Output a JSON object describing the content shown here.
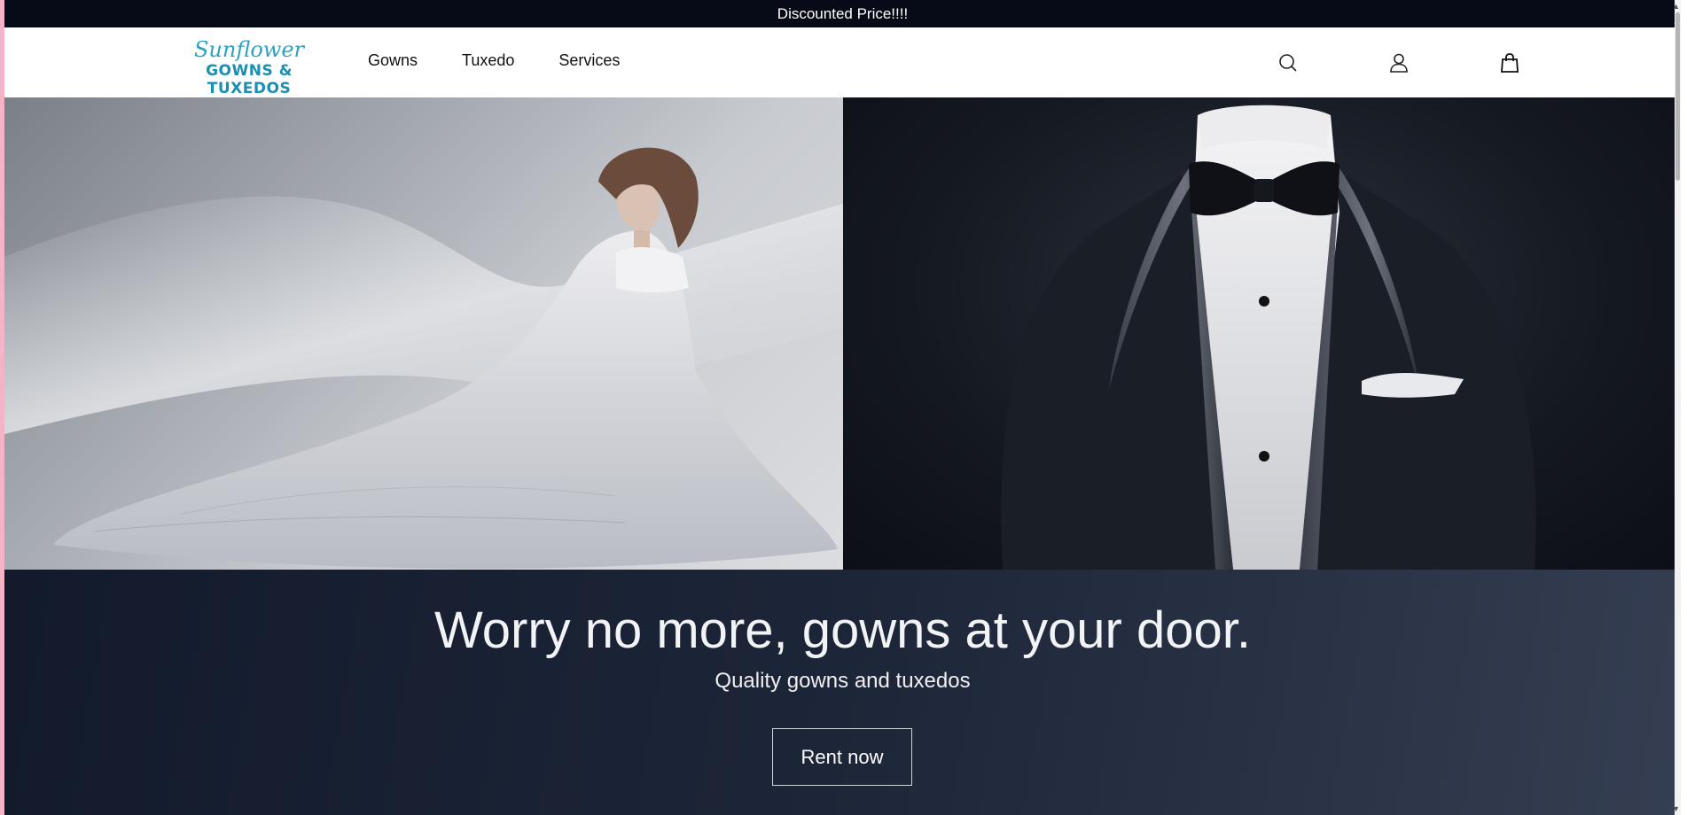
{
  "announcement": "Discounted Price!!!!",
  "brand": {
    "script": "Sunflower",
    "name": "GOWNS & TUXEDOS"
  },
  "nav": [
    "Gowns",
    "Tuxedo",
    "Services"
  ],
  "icons": {
    "search": "search-icon",
    "account": "user-icon",
    "cart": "shopping-bag-icon"
  },
  "hero": {
    "left_image": "bride-in-white-ball-gown",
    "right_image": "black-tuxedo-with-bow-tie"
  },
  "cta": {
    "headline": "Worry no more, gowns at your door.",
    "subhead": "Quality gowns and tuxedos",
    "button": "Rent now"
  },
  "colors": {
    "accent": "#1b8fb0",
    "dark": "#070b17",
    "band": "#1d2538"
  }
}
